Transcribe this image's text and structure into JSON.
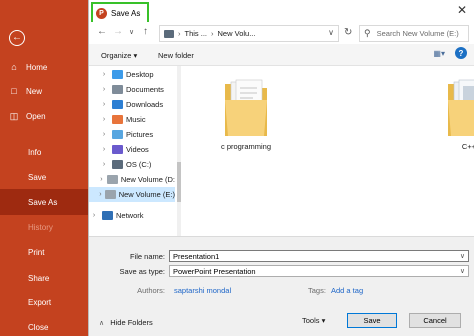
{
  "sidebar": {
    "back_icon": "back-arrow-icon",
    "items": [
      {
        "label": "Home",
        "icon": "home-icon"
      },
      {
        "label": "New",
        "icon": "new-document-icon"
      },
      {
        "label": "Open",
        "icon": "open-folder-icon"
      },
      {
        "label": "Info"
      },
      {
        "label": "Save"
      },
      {
        "label": "Save As",
        "active": true
      },
      {
        "label": "History",
        "disabled": true
      },
      {
        "label": "Print"
      },
      {
        "label": "Share"
      },
      {
        "label": "Export"
      },
      {
        "label": "Close"
      }
    ],
    "color": "#c4421f",
    "active_color": "#9e2a10"
  },
  "dialog": {
    "title": "Save As",
    "address": {
      "segments": [
        "This ...",
        "New Volu..."
      ],
      "refresh_icon": "refresh-icon"
    },
    "search_placeholder": "Search New Volume (E:)",
    "toolbar": {
      "organize": "Organize ▾",
      "new_folder": "New folder"
    },
    "tree": [
      {
        "label": "Desktop",
        "icon_color": "#3d9be9"
      },
      {
        "label": "Documents",
        "icon_color": "#7f8c99"
      },
      {
        "label": "Downloads",
        "icon_color": "#2d7fd3"
      },
      {
        "label": "Music",
        "icon_color": "#e8743b"
      },
      {
        "label": "Pictures",
        "icon_color": "#58a6e0"
      },
      {
        "label": "Videos",
        "icon_color": "#6a5acd"
      },
      {
        "label": "OS (C:)",
        "icon_color": "#5b6b7b"
      },
      {
        "label": "New Volume (D:",
        "icon_color": "#9aa4ad"
      },
      {
        "label": "New Volume (E:)",
        "icon_color": "#9aa4ad",
        "selected": true
      },
      {
        "label": "Network",
        "icon_color": "#2f6fb5"
      }
    ],
    "folders": [
      {
        "label": "c programming"
      },
      {
        "label": "C++"
      }
    ],
    "file_name_label": "File name:",
    "file_name_value": "Presentation1",
    "save_type_label": "Save as type:",
    "save_type_value": "PowerPoint Presentation",
    "authors_label": "Authors:",
    "authors_value": "saptarshi mondal",
    "tags_label": "Tags:",
    "tags_value": "Add a tag",
    "hide_folders": "Hide Folders",
    "tools": "Tools ▾",
    "save_button": "Save",
    "cancel_button": "Cancel",
    "highlight_color": "#38c129"
  }
}
